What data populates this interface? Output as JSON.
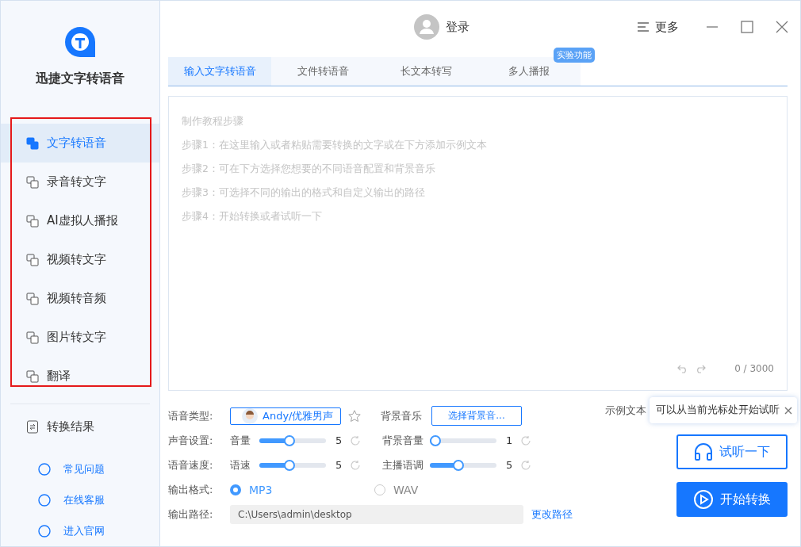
{
  "app": {
    "name": "迅捷文字转语音"
  },
  "sidebar": {
    "items": [
      {
        "label": "文字转语音",
        "selected": true
      },
      {
        "label": "录音转文字",
        "selected": false
      },
      {
        "label": "AI虚拟人播报",
        "selected": false
      },
      {
        "label": "视频转文字",
        "selected": false
      },
      {
        "label": "视频转音频",
        "selected": false
      },
      {
        "label": "图片转文字",
        "selected": false
      },
      {
        "label": "翻译",
        "selected": false
      }
    ],
    "results": "转换结果",
    "links": [
      "常见问题",
      "在线客服",
      "进入官网"
    ]
  },
  "header": {
    "login": "登录",
    "more": "更多"
  },
  "tabs": [
    {
      "label": "输入文字转语音",
      "selected": true
    },
    {
      "label": "文件转语音",
      "selected": false
    },
    {
      "label": "长文本转写",
      "selected": false
    },
    {
      "label": "多人播报",
      "selected": false,
      "badge": "实验功能"
    }
  ],
  "editor": {
    "placeholder_lines": [
      "制作教程步骤",
      "步骤1：在这里输入或者粘贴需要转换的文字或在下方添加示例文本",
      "步骤2：可在下方选择您想要的不同语音配置和背景音乐",
      "步骤3：可选择不同的输出的格式和自定义输出的路径",
      "步骤4：开始转换或者试听一下"
    ],
    "count": "0 / 3000"
  },
  "settings": {
    "voice_label": "语音类型:",
    "voice": "Andy/优雅男声",
    "bgm_label": "背景音乐",
    "bgm_button": "选择背景音...",
    "sample_label": "示例文本",
    "sound_label": "声音设置:",
    "speed_label": "语音速度:",
    "sliders": [
      {
        "label": "音量",
        "level": 0.44,
        "reading": "5"
      },
      {
        "label": "背景音量",
        "level": 0,
        "reading": "1"
      },
      {
        "label": "语速",
        "level": 0.44,
        "reading": "5"
      },
      {
        "label": "主播语调",
        "level": 0.42,
        "reading": "5"
      }
    ],
    "format_label": "输出格式:",
    "formats": [
      {
        "label": "MP3",
        "selected": true
      },
      {
        "label": "WAV",
        "selected": false
      }
    ],
    "path_label": "输出路径:",
    "path": "C:\\Users\\admin\\desktop",
    "change_path": "更改路径"
  },
  "tooltip": "可以从当前光标处开始试听",
  "buttons": {
    "listen": "试听一下",
    "start": "开始转换"
  }
}
